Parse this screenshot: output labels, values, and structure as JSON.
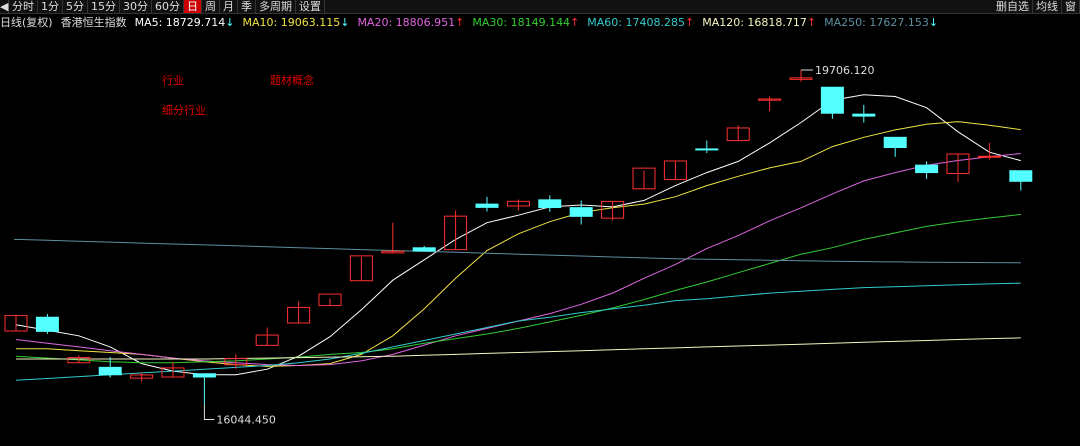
{
  "toolbar": {
    "prev_arrow": "◀",
    "periods": [
      "分时",
      "1分",
      "5分",
      "15分",
      "30分",
      "60分",
      "日",
      "周",
      "月",
      "季",
      "多周期"
    ],
    "active_period": "日",
    "settings": "设置",
    "right_buttons": [
      "删自选",
      "均线",
      "窗"
    ]
  },
  "header": {
    "index_label": "日线(复权)",
    "instrument": "香港恒生指数"
  },
  "moving_averages": [
    {
      "label": "MA5: 18729.714",
      "arrow": "↓",
      "color": "#ffffff"
    },
    {
      "label": "MA10: 19063.115",
      "arrow": "↓",
      "color": "#f0e442"
    },
    {
      "label": "MA20: 18806.951",
      "arrow": "↑",
      "color": "#e066e0"
    },
    {
      "label": "MA30: 18149.144",
      "arrow": "↑",
      "color": "#33cc33"
    },
    {
      "label": "MA60: 17408.285",
      "arrow": "↑",
      "color": "#33cccc"
    },
    {
      "label": "MA120: 16818.717",
      "arrow": "↑",
      "color": "#f5f5c0"
    },
    {
      "label": "MA250: 17627.153",
      "arrow": "↓",
      "color": "#5f8fa0"
    }
  ],
  "concept_tags": {
    "industry": "行业",
    "sub_industry": "细分行业",
    "theme": "题材概念"
  },
  "colors": {
    "up": "#ff3030",
    "down": "#54ffff",
    "arrow_up": "#ff3030",
    "arrow_down": "#54ffff"
  },
  "chart_data": {
    "type": "candlestick",
    "ylim": [
      15900,
      19900
    ],
    "high_annotation": "19706.120",
    "low_annotation": "16044.450",
    "candles": [
      {
        "o": 16892,
        "h": 17070,
        "l": 16892,
        "c": 17058
      },
      {
        "o": 17040,
        "h": 17075,
        "l": 16860,
        "c": 16888
      },
      {
        "o": 16550,
        "h": 16630,
        "l": 16550,
        "c": 16605
      },
      {
        "o": 16500,
        "h": 16610,
        "l": 16390,
        "c": 16420
      },
      {
        "o": 16384,
        "h": 16445,
        "l": 16345,
        "c": 16418
      },
      {
        "o": 16396,
        "h": 16555,
        "l": 16396,
        "c": 16494
      },
      {
        "o": 16431,
        "h": 16431,
        "l": 16100,
        "c": 16396
      },
      {
        "o": 16528,
        "h": 16640,
        "l": 16485,
        "c": 16596
      },
      {
        "o": 16737,
        "h": 16930,
        "l": 16737,
        "c": 16848
      },
      {
        "o": 16978,
        "h": 17210,
        "l": 16978,
        "c": 17146
      },
      {
        "o": 17166,
        "h": 17244,
        "l": 17166,
        "c": 17290
      },
      {
        "o": 17434,
        "h": 17690,
        "l": 17434,
        "c": 17702
      },
      {
        "o": 17734,
        "h": 18060,
        "l": 17734,
        "c": 17751
      },
      {
        "o": 17789,
        "h": 17810,
        "l": 17789,
        "c": 17754
      },
      {
        "o": 17769,
        "h": 18190,
        "l": 17769,
        "c": 18130
      },
      {
        "o": 18260,
        "h": 18340,
        "l": 18180,
        "c": 18225
      },
      {
        "o": 18240,
        "h": 18310,
        "l": 18190,
        "c": 18290
      },
      {
        "o": 18306,
        "h": 18355,
        "l": 18178,
        "c": 18223
      },
      {
        "o": 18222,
        "h": 18300,
        "l": 18040,
        "c": 18128
      },
      {
        "o": 18109,
        "h": 18288,
        "l": 18084,
        "c": 18289
      },
      {
        "o": 18425,
        "h": 18620,
        "l": 18425,
        "c": 18648
      },
      {
        "o": 18525,
        "h": 18730,
        "l": 18525,
        "c": 18725
      },
      {
        "o": 18855,
        "h": 18945,
        "l": 18810,
        "c": 18848
      },
      {
        "o": 18945,
        "h": 19110,
        "l": 18945,
        "c": 19081
      },
      {
        "o": 19380,
        "h": 19420,
        "l": 19260,
        "c": 19393
      },
      {
        "o": 19605,
        "h": 19706,
        "l": 19580,
        "c": 19621
      },
      {
        "o": 19520,
        "h": 19520,
        "l": 19180,
        "c": 19240
      },
      {
        "o": 19230,
        "h": 19330,
        "l": 19140,
        "c": 19209
      },
      {
        "o": 18980,
        "h": 18980,
        "l": 18770,
        "c": 18870
      },
      {
        "o": 18680,
        "h": 18720,
        "l": 18530,
        "c": 18600
      },
      {
        "o": 18590,
        "h": 18800,
        "l": 18500,
        "c": 18800
      },
      {
        "o": 18770,
        "h": 18920,
        "l": 18740,
        "c": 18776
      },
      {
        "o": 18620,
        "h": 18620,
        "l": 18406,
        "c": 18506
      }
    ],
    "ma_lines": [
      {
        "name": "MA5",
        "color": "#ffffff",
        "values": [
          16960,
          16900,
          16840,
          16720,
          16540,
          16460,
          16420,
          16420,
          16480,
          16620,
          16830,
          17120,
          17440,
          17660,
          17880,
          18060,
          18140,
          18230,
          18250,
          18230,
          18300,
          18460,
          18600,
          18720,
          18920,
          19140,
          19380,
          19440,
          19420,
          19300,
          19040,
          18820,
          18729
        ]
      },
      {
        "name": "MA10",
        "color": "#f0e442",
        "values": [
          16700,
          16700,
          16680,
          16660,
          16640,
          16600,
          16560,
          16530,
          16510,
          16520,
          16540,
          16640,
          16840,
          17130,
          17460,
          17760,
          17940,
          18070,
          18170,
          18220,
          18260,
          18340,
          18460,
          18560,
          18650,
          18720,
          18880,
          18980,
          19060,
          19120,
          19150,
          19110,
          19063
        ]
      },
      {
        "name": "MA20",
        "color": "#e066e0",
        "values": [
          16800,
          16760,
          16720,
          16680,
          16640,
          16600,
          16570,
          16550,
          16530,
          16520,
          16530,
          16570,
          16640,
          16740,
          16840,
          16920,
          17000,
          17080,
          17180,
          17300,
          17460,
          17610,
          17780,
          17920,
          18080,
          18220,
          18370,
          18510,
          18600,
          18680,
          18730,
          18770,
          18806
        ]
      },
      {
        "name": "MA30",
        "color": "#33cc33",
        "values": [
          16620,
          16600,
          16580,
          16560,
          16550,
          16550,
          16560,
          16570,
          16590,
          16610,
          16640,
          16660,
          16700,
          16760,
          16810,
          16860,
          16920,
          16990,
          17060,
          17140,
          17230,
          17330,
          17420,
          17520,
          17620,
          17720,
          17790,
          17880,
          17950,
          18020,
          18070,
          18110,
          18149
        ]
      },
      {
        "name": "MA60",
        "color": "#33cccc",
        "values": [
          16360,
          16380,
          16400,
          16420,
          16440,
          16460,
          16480,
          16500,
          16520,
          16550,
          16590,
          16650,
          16720,
          16790,
          16860,
          16930,
          17000,
          17040,
          17090,
          17130,
          17170,
          17220,
          17240,
          17270,
          17300,
          17320,
          17340,
          17360,
          17370,
          17380,
          17390,
          17400,
          17408
        ]
      },
      {
        "name": "MA120",
        "color": "#f5f5c0",
        "values": [
          16590,
          16590,
          16590,
          16590,
          16590,
          16590,
          16590,
          16595,
          16600,
          16605,
          16610,
          16615,
          16620,
          16630,
          16640,
          16650,
          16660,
          16670,
          16680,
          16690,
          16700,
          16710,
          16720,
          16730,
          16740,
          16750,
          16760,
          16770,
          16780,
          16790,
          16800,
          16810,
          16818
        ]
      },
      {
        "name": "MA250",
        "color": "#5f8fa0",
        "values": [
          17880,
          17870,
          17860,
          17850,
          17840,
          17830,
          17820,
          17810,
          17800,
          17790,
          17780,
          17770,
          17760,
          17750,
          17740,
          17730,
          17720,
          17710,
          17700,
          17690,
          17680,
          17670,
          17665,
          17660,
          17655,
          17650,
          17645,
          17640,
          17637,
          17634,
          17631,
          17629,
          17627
        ]
      }
    ]
  }
}
